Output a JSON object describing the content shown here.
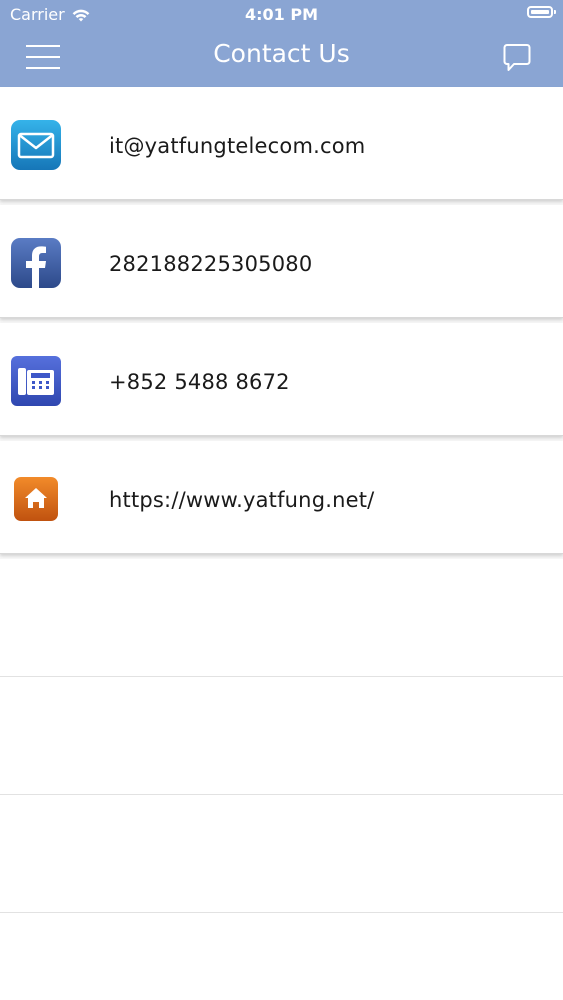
{
  "status_bar": {
    "carrier": "Carrier",
    "time": "4:01 PM"
  },
  "nav": {
    "title": "Contact Us",
    "left_icon": "hamburger-menu-icon",
    "right_icon": "chat-bubble-icon"
  },
  "contacts": [
    {
      "icon": "email-icon",
      "text": "it@yatfungtelecom.com",
      "color": "#1e8fd0"
    },
    {
      "icon": "facebook-icon",
      "text": "282188225305080",
      "color": "#3b5998"
    },
    {
      "icon": "phone-fax-icon",
      "text": "+852 5488 8672",
      "color": "#3d57c8"
    },
    {
      "icon": "home-icon",
      "text": "https://www.yatfung.net/",
      "color": "#e0701a"
    }
  ],
  "colors": {
    "header": "#8aa5d3",
    "text": "#1a1a1a",
    "divider": "#d8d8d8"
  }
}
